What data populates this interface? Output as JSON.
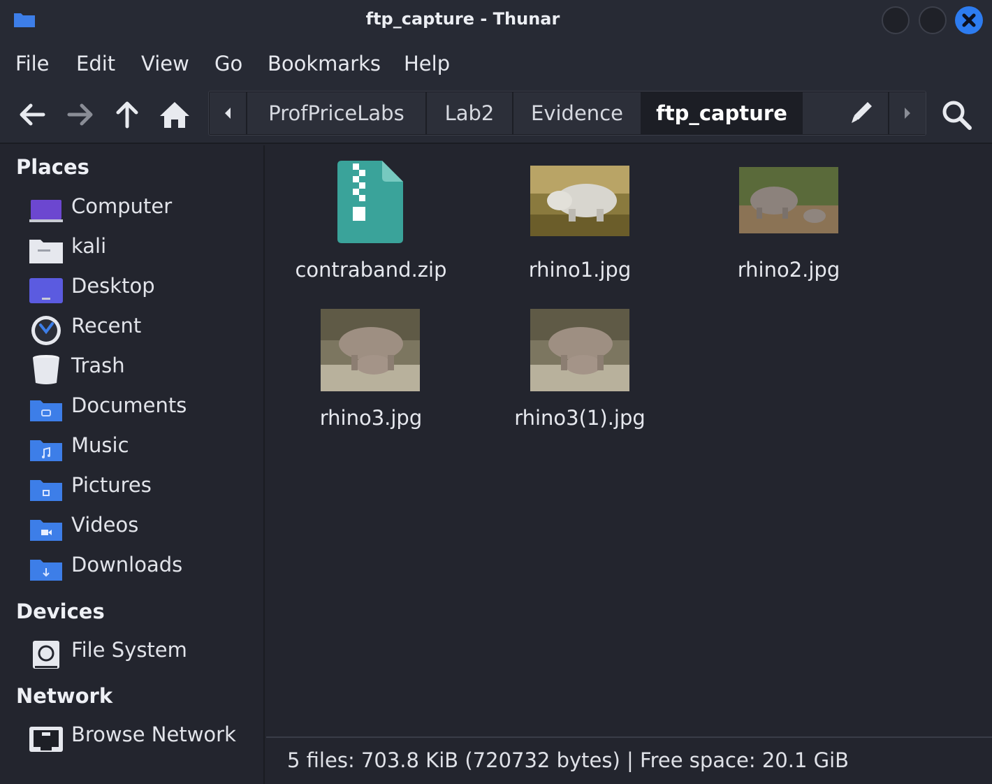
{
  "window": {
    "title": "ftp_capture - Thunar"
  },
  "menu": [
    "File",
    "Edit",
    "View",
    "Go",
    "Bookmarks",
    "Help"
  ],
  "pathbar": {
    "crumbs": [
      "ProfPriceLabs",
      "Lab2",
      "Evidence",
      "ftp_capture"
    ]
  },
  "sidebar": {
    "places_title": "Places",
    "places": [
      "Computer",
      "kali",
      "Desktop",
      "Recent",
      "Trash",
      "Documents",
      "Music",
      "Pictures",
      "Videos",
      "Downloads"
    ],
    "devices_title": "Devices",
    "devices": [
      "File System"
    ],
    "network_title": "Network",
    "network": [
      "Browse Network"
    ]
  },
  "files": [
    "contraband.zip",
    "rhino1.jpg",
    "rhino2.jpg",
    "rhino3.jpg",
    "rhino3(1).jpg"
  ],
  "status": "5 files: 703.8 KiB (720732 bytes)  |  Free space: 20.1 GiB",
  "colors": {
    "accent": "#2d7cf0",
    "folder": "#3d7ee8",
    "zip": "#3aa39a",
    "background": "#23252e"
  },
  "icons": {
    "toolbar": [
      "back-arrow-icon",
      "forward-arrow-icon",
      "up-arrow-icon",
      "home-icon",
      "search-icon"
    ],
    "places": [
      "computer-icon",
      "home-folder-icon",
      "desktop-icon",
      "clock-icon",
      "trash-icon",
      "documents-folder-icon",
      "music-folder-icon",
      "pictures-folder-icon",
      "videos-folder-icon",
      "downloads-folder-icon"
    ]
  }
}
